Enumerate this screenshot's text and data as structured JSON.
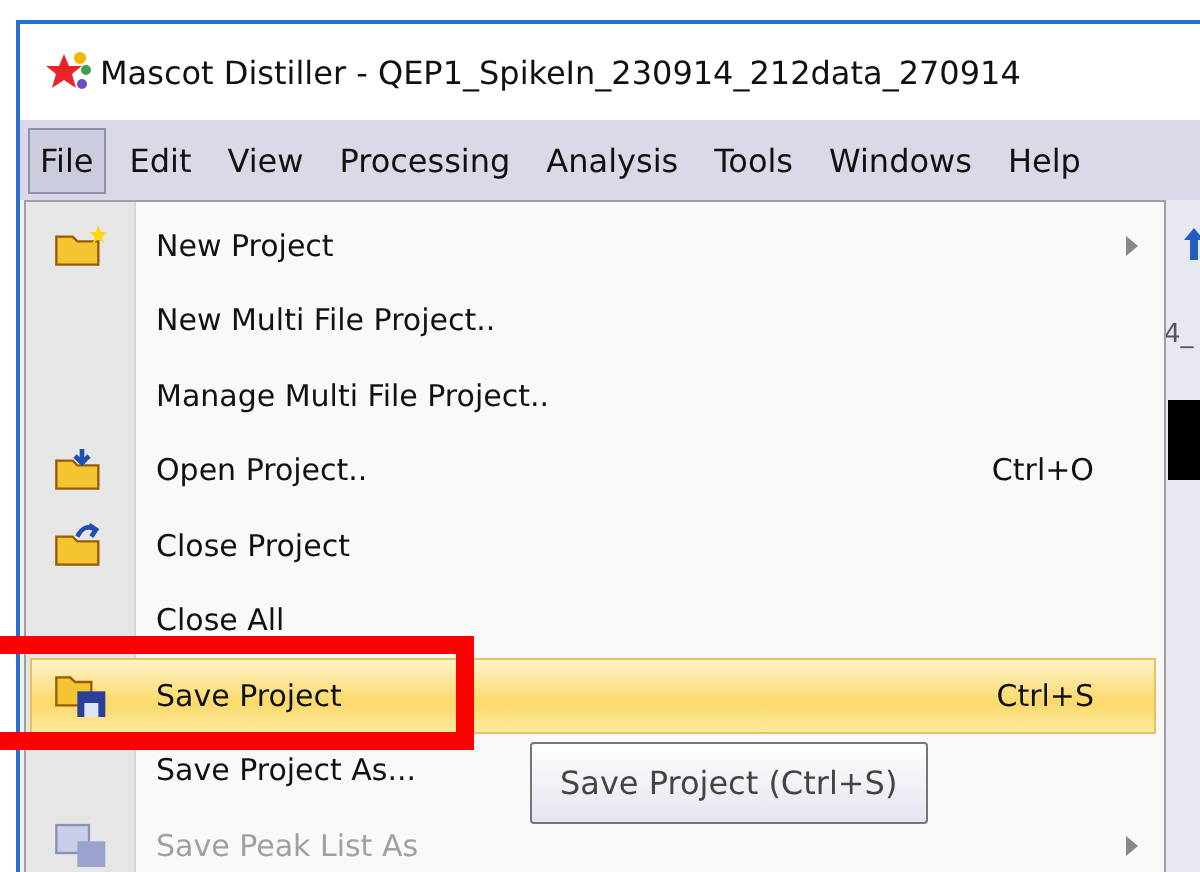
{
  "window": {
    "title": "Mascot Distiller - QEP1_SpikeIn_230914_212data_270914"
  },
  "menubar": [
    {
      "label": "File",
      "selected": true
    },
    {
      "label": "Edit",
      "selected": false
    },
    {
      "label": "View",
      "selected": false
    },
    {
      "label": "Processing",
      "selected": false
    },
    {
      "label": "Analysis",
      "selected": false
    },
    {
      "label": "Tools",
      "selected": false
    },
    {
      "label": "Windows",
      "selected": false
    },
    {
      "label": "Help",
      "selected": false
    }
  ],
  "background": {
    "tab_label": "4_"
  },
  "file_menu": [
    {
      "label": "New Project",
      "kind": "new",
      "submenu": true,
      "disabled": false,
      "selected": false
    },
    {
      "label": "New Multi File Project..",
      "kind": "plain",
      "submenu": false,
      "disabled": false,
      "selected": false
    },
    {
      "label": "Manage Multi File Project..",
      "kind": "plain",
      "submenu": false,
      "disabled": false,
      "selected": false
    },
    {
      "label": "Open Project..",
      "shortcut": "Ctrl+O",
      "kind": "open",
      "submenu": false,
      "disabled": false,
      "selected": false
    },
    {
      "label": "Close Project",
      "kind": "close",
      "submenu": false,
      "disabled": false,
      "selected": false
    },
    {
      "label": "Close All",
      "kind": "plain",
      "submenu": false,
      "disabled": false,
      "selected": false
    },
    {
      "label": "Save Project",
      "shortcut": "Ctrl+S",
      "kind": "save",
      "submenu": false,
      "disabled": false,
      "selected": true
    },
    {
      "label": "Save Project As...",
      "kind": "plain",
      "submenu": false,
      "disabled": false,
      "selected": false
    },
    {
      "label": "Save Peak List As",
      "kind": "table",
      "submenu": true,
      "disabled": true,
      "selected": false
    }
  ],
  "tooltip": "Save Project (Ctrl+S)"
}
